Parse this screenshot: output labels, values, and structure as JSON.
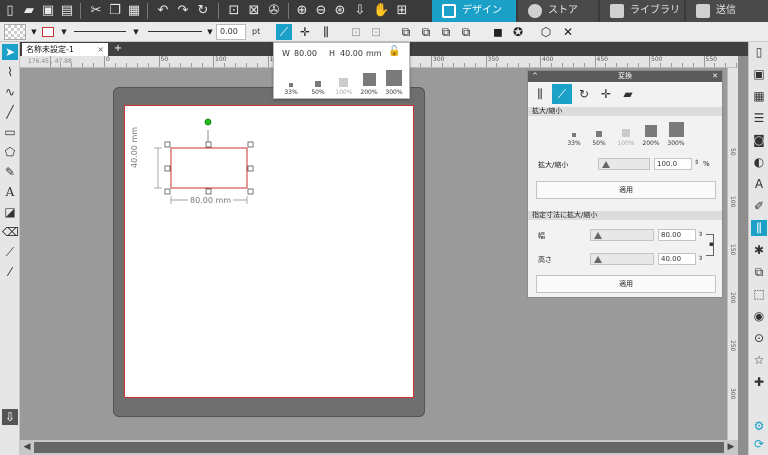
{
  "topbar": {
    "icons": [
      "new-file",
      "open-folder",
      "save",
      "print",
      "cut",
      "copy",
      "paste",
      "undo",
      "redo",
      "rotate",
      "group",
      "ungroup",
      "replicate",
      "zoom-in",
      "zoom-out",
      "zoom-fit",
      "move-down",
      "pan-hand",
      "add-page"
    ],
    "tabs": [
      {
        "label": "デザイン",
        "active": true
      },
      {
        "label": "ストア",
        "active": false
      },
      {
        "label": "ライブラリ",
        "active": false
      },
      {
        "label": "送信",
        "active": false
      }
    ]
  },
  "optbar": {
    "line_width": "0.00",
    "line_unit": "pt"
  },
  "doc": {
    "tab_title": "名称未設定-1",
    "close": "×",
    "add": "+",
    "coord_readout": "176.45 , 47.88"
  },
  "ruler": {
    "h_labels": [
      "0",
      "50",
      "100",
      "150",
      "200",
      "250",
      "300",
      "350",
      "400",
      "450",
      "500",
      "550"
    ],
    "v_labels": [
      "50",
      "100",
      "150",
      "200",
      "250",
      "300"
    ]
  },
  "scale_popup": {
    "w_label": "W",
    "w_value": "80.00",
    "h_label": "H",
    "h_value": "40.00",
    "unit": "mm",
    "presets": [
      "33%",
      "50%",
      "100%",
      "200%",
      "300%"
    ]
  },
  "shape": {
    "width_dim": "80.00 mm",
    "height_dim": "40.00 mm"
  },
  "panel": {
    "title": "変換",
    "section_scale": "拡大/縮小",
    "presets": [
      "33%",
      "50%",
      "100%",
      "200%",
      "300%"
    ],
    "scale_label": "拡大/縮小",
    "scale_value": "100.0",
    "scale_unit": "%",
    "apply1": "適用",
    "section_size": "指定寸法に拡大/縮小",
    "width_label": "幅",
    "width_value": "80.00",
    "height_label": "高さ",
    "height_value": "40.00",
    "apply2": "適用"
  },
  "colors": {
    "accent": "#1ba0c8",
    "toolbar_dark": "#3a3a3a",
    "cut_line": "#cc3333",
    "handle_green": "#22bb22"
  }
}
